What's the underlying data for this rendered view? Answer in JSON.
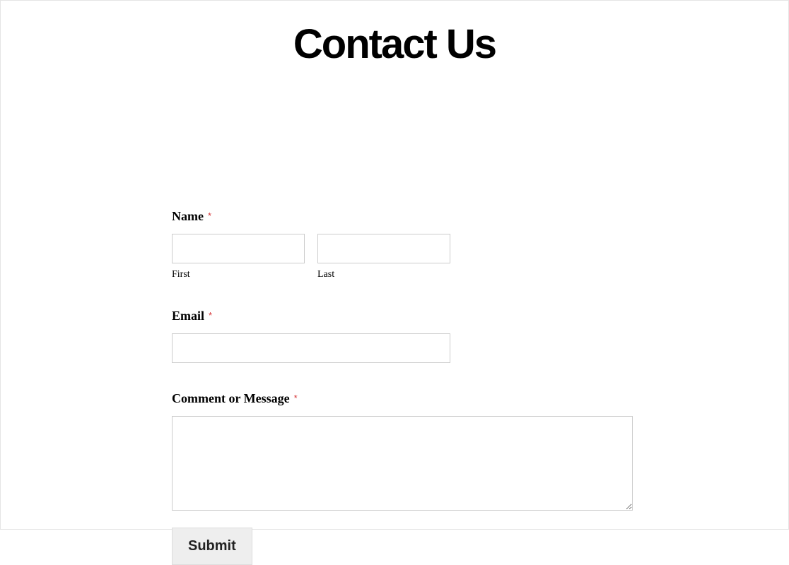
{
  "page": {
    "title": "Contact Us"
  },
  "form": {
    "name": {
      "label": "Name",
      "required_mark": "*",
      "first": {
        "sublabel": "First",
        "value": ""
      },
      "last": {
        "sublabel": "Last",
        "value": ""
      }
    },
    "email": {
      "label": "Email",
      "required_mark": "*",
      "value": ""
    },
    "message": {
      "label": "Comment or Message",
      "required_mark": "*",
      "value": ""
    },
    "submit": {
      "label": "Submit"
    }
  }
}
